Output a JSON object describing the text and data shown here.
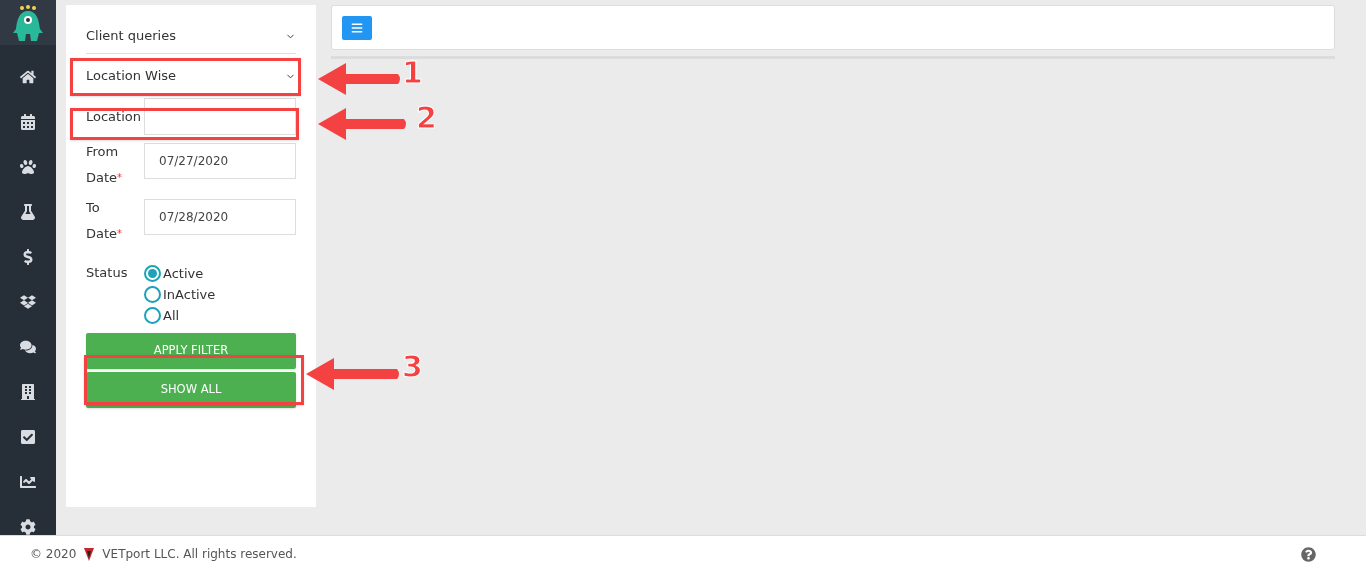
{
  "filter_panel": {
    "query_type": {
      "value": "Client queries"
    },
    "grouping": {
      "value": "Location Wise"
    },
    "location": {
      "label": "Location"
    },
    "from_date": {
      "label": "From Date",
      "required_mark": "*",
      "value": "07/27/2020"
    },
    "to_date": {
      "label": "To Date",
      "required_mark": "*",
      "value": "07/28/2020"
    },
    "status": {
      "label": "Status",
      "options": [
        {
          "label": "Active",
          "selected": true
        },
        {
          "label": "InActive",
          "selected": false
        },
        {
          "label": "All",
          "selected": false
        }
      ]
    },
    "buttons": [
      "APPLY FILTER",
      "SHOW ALL"
    ]
  },
  "annotations": [
    {
      "label": "1"
    },
    {
      "label": "2"
    },
    {
      "label": "3"
    }
  ],
  "footer": {
    "copyright": "© 2020",
    "company": "VETport LLC. All rights reserved."
  }
}
